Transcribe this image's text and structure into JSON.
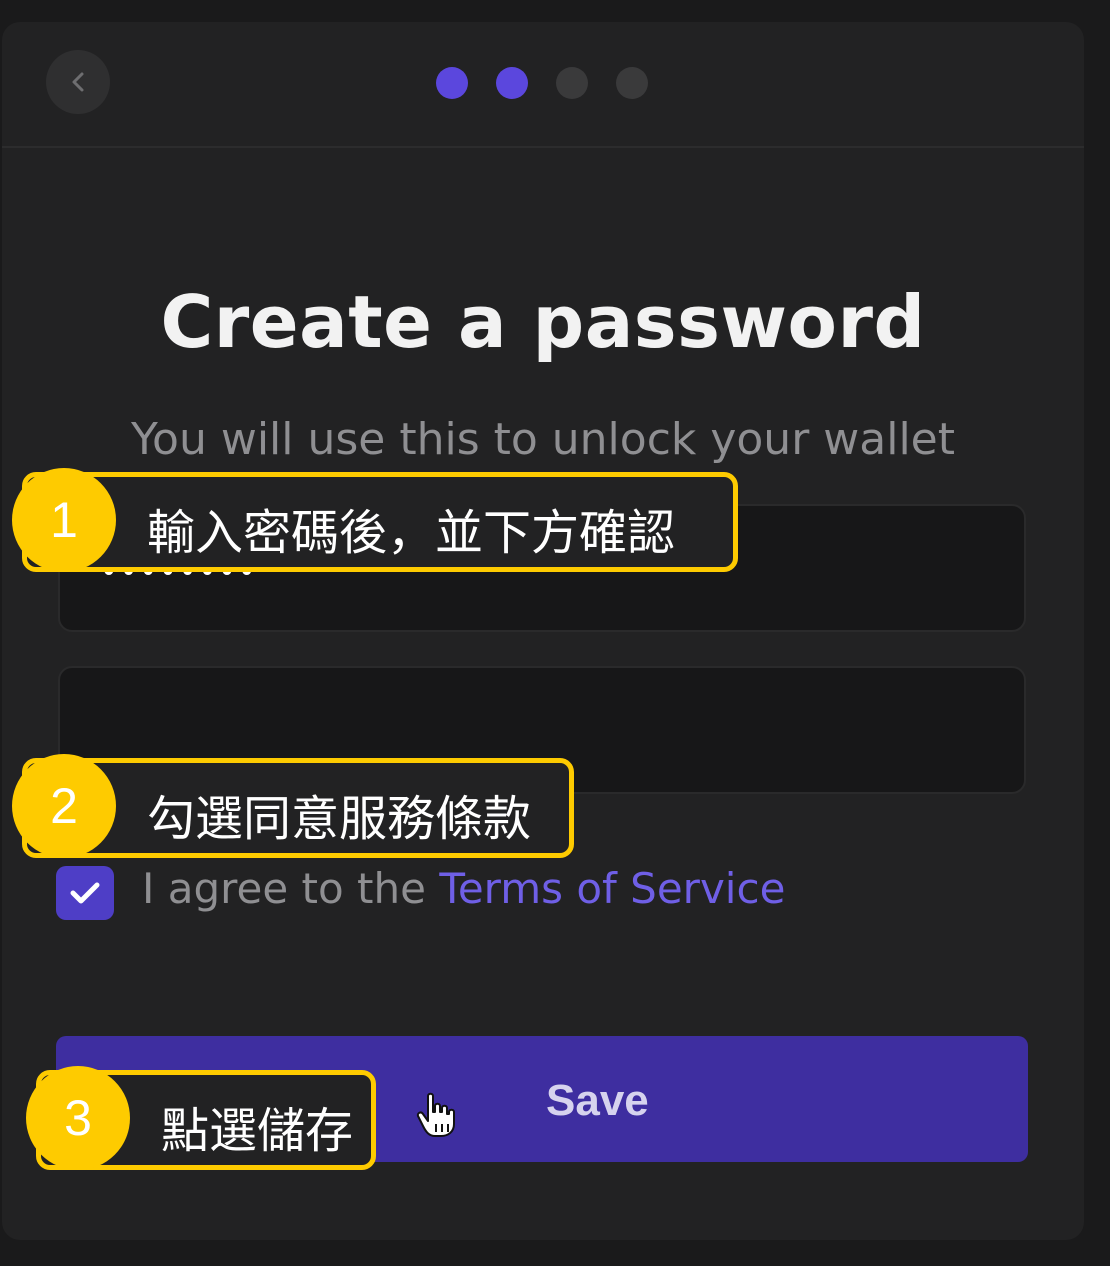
{
  "header": {
    "steps_total": 4,
    "steps_completed": 2
  },
  "content": {
    "title": "Create a password",
    "subtitle": "You will use this to unlock your wallet"
  },
  "form": {
    "password_value": "••••••••",
    "confirm_value": "••••••••",
    "agree_checked": true,
    "agree_prefix": "I agree to the",
    "terms_link": "Terms of Service",
    "save_label": "Save"
  },
  "annotations": [
    {
      "number": "1",
      "text": "輸入密碼後，並下方確認"
    },
    {
      "number": "2",
      "text": "勾選同意服務條款"
    },
    {
      "number": "3",
      "text": "點選儲存"
    }
  ],
  "colors": {
    "accent": "#5b47dd",
    "button": "#3e2ea0",
    "link": "#6f5fe6",
    "annotation": "#fecb00"
  }
}
